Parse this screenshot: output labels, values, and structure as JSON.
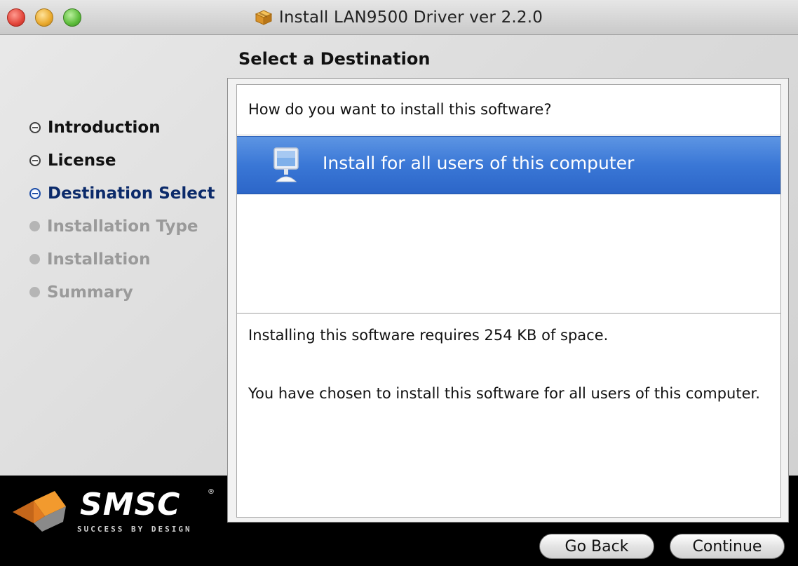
{
  "window": {
    "title": "Install LAN9500 Driver ver 2.2.0"
  },
  "header": {
    "title": "Select a Destination"
  },
  "steps": [
    {
      "label": "Introduction",
      "state": "done"
    },
    {
      "label": "License",
      "state": "done"
    },
    {
      "label": "Destination Select",
      "state": "active"
    },
    {
      "label": "Installation Type",
      "state": "pending"
    },
    {
      "label": "Installation",
      "state": "pending"
    },
    {
      "label": "Summary",
      "state": "pending"
    }
  ],
  "branding": {
    "logo_text": "SMSC",
    "registered_mark": "®",
    "tagline": "SUCCESS BY DESIGN"
  },
  "main": {
    "question": "How do you want to install this software?",
    "options": [
      {
        "label": "Install for all users of this computer",
        "icon": "computer-icon",
        "selected": true
      }
    ],
    "space_info": "Installing this software requires 254 KB of space.",
    "choice_info": "You have chosen to install this software for all users of this computer."
  },
  "buttons": {
    "back": "Go Back",
    "continue": "Continue"
  },
  "colors": {
    "selection": "#3a77d6",
    "active_step": "#0b2a6a",
    "pending_step": "#9a9a9a",
    "logo_orange": "#f08a1c"
  }
}
